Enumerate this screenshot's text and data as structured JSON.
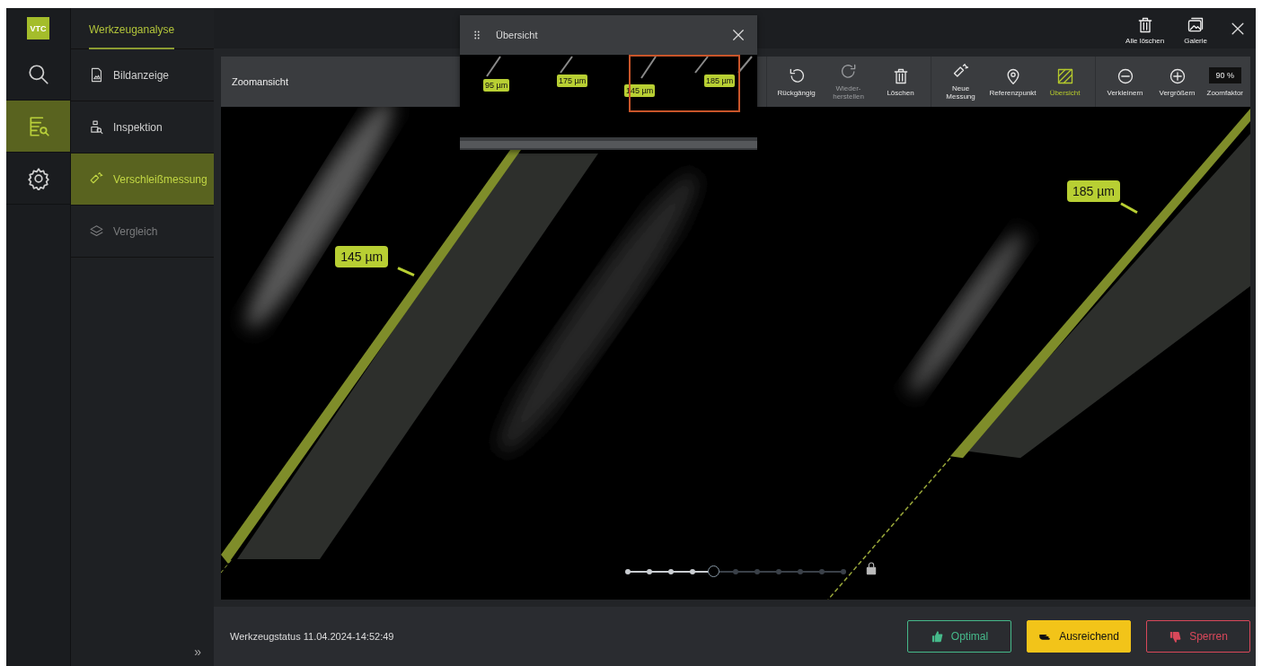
{
  "rail": {
    "logo": "VTC",
    "items": [
      {
        "kind": "search",
        "selected": false
      },
      {
        "kind": "analysis",
        "selected": true
      },
      {
        "kind": "settings",
        "selected": false
      }
    ]
  },
  "nav": {
    "title": "Werkzeuganalyse",
    "items": [
      {
        "kind": "image",
        "label": "Bildanzeige",
        "selected": false,
        "disabled": false
      },
      {
        "kind": "inspect",
        "label": "Inspektion",
        "selected": false,
        "disabled": false
      },
      {
        "kind": "measure",
        "label": "Verschleißmessung",
        "selected": true,
        "disabled": false
      },
      {
        "kind": "layers",
        "label": "Vergleich",
        "selected": false,
        "disabled": true
      }
    ],
    "collapse": "»"
  },
  "topbar": {
    "actions": [
      {
        "kind": "trash",
        "label": "Alle löschen"
      },
      {
        "kind": "gallery",
        "label": "Galerie"
      }
    ]
  },
  "toolbar": {
    "title": "Zoomansicht",
    "groups": [
      [
        {
          "kind": "undo",
          "label": "Rückgängig",
          "disabled": false,
          "selected": false
        },
        {
          "kind": "redo",
          "label": "Wieder-herstellen",
          "disabled": true,
          "selected": false
        },
        {
          "kind": "trash",
          "label": "Löschen",
          "disabled": false,
          "selected": false
        }
      ],
      [
        {
          "kind": "measure",
          "label": "Neue Messung",
          "disabled": false,
          "selected": false
        },
        {
          "kind": "pin",
          "label": "Referenzpunkt",
          "disabled": false,
          "selected": false
        },
        {
          "kind": "overview",
          "label": "Übersicht",
          "disabled": false,
          "selected": true
        }
      ],
      [
        {
          "kind": "minus",
          "label": "Verkleinern",
          "disabled": false,
          "selected": false
        },
        {
          "kind": "plus",
          "label": "Vergrößern",
          "disabled": false,
          "selected": false
        }
      ]
    ],
    "zoom": {
      "value": "90 %",
      "label": "Zoomfaktor"
    }
  },
  "overview": {
    "title": "Übersicht",
    "labels": [
      "95 µm",
      "175 µm",
      "145 µm",
      "185 µm"
    ]
  },
  "image": {
    "measurements": [
      "145 µm",
      "185 µm"
    ],
    "slider": {
      "level": 0.4
    },
    "locked": true
  },
  "status": {
    "text": "Werkzeugstatus 11.04.2024-14:52:49",
    "buttons": [
      {
        "kind": "optimal",
        "label": "Optimal",
        "selected": false
      },
      {
        "kind": "sufficient",
        "label": "Ausreichend",
        "selected": true
      },
      {
        "kind": "block",
        "label": "Sperren",
        "selected": false
      }
    ]
  }
}
